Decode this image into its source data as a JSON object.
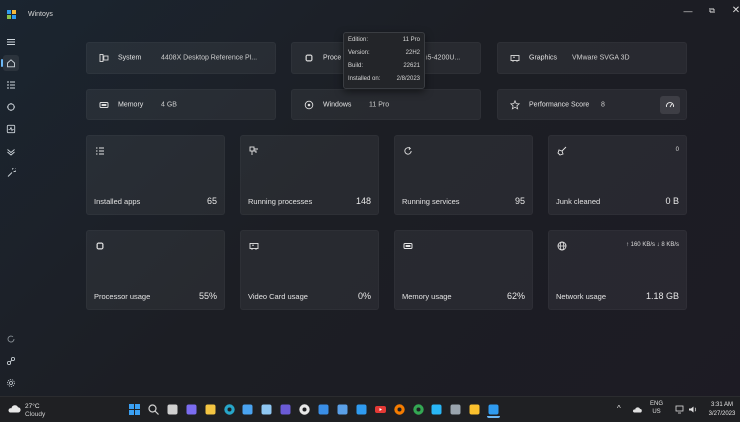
{
  "window": {
    "title": "Wintoys",
    "logo_colors": [
      "#2f9bf0",
      "#f6b93b",
      "#8bc34a",
      "#2f9bf0"
    ],
    "controls": {
      "minimize": "—",
      "maximize": "⧉",
      "close": "✕"
    }
  },
  "accent_color": "#6cb8f6",
  "nav": {
    "top": [
      {
        "name": "menu-icon",
        "active": false
      },
      {
        "name": "home-icon",
        "active": true
      },
      {
        "name": "apps-list-icon",
        "active": false
      },
      {
        "name": "services-icon",
        "active": false
      },
      {
        "name": "health-icon",
        "active": false
      },
      {
        "name": "boost-icon",
        "active": false
      },
      {
        "name": "tweaks-icon",
        "active": false
      }
    ],
    "bottom": [
      {
        "name": "refresh-icon"
      },
      {
        "name": "share-icon"
      },
      {
        "name": "settings-icon"
      }
    ]
  },
  "info": {
    "system": {
      "label": "System",
      "value": "4408X Desktop Reference Pl...",
      "icon": "system-icon"
    },
    "processor": {
      "label": "Proce",
      "value": "i5-4200U...",
      "icon": "processor-icon"
    },
    "graphics": {
      "label": "Graphics",
      "value": "VMware SVGA 3D",
      "icon": "graphics-icon"
    },
    "memory": {
      "label": "Memory",
      "value": "4 GB",
      "icon": "memory-icon"
    },
    "windows": {
      "label": "Windows",
      "value": "11 Pro",
      "icon": "windows-icon"
    },
    "performance": {
      "label": "Performance Score",
      "value": "8",
      "icon": "star-icon",
      "button_icon": "speedometer-icon"
    }
  },
  "tooltip": {
    "rows": [
      {
        "key": "Edition:",
        "value": "11 Pro"
      },
      {
        "key": "Version:",
        "value": "22H2"
      },
      {
        "key": "Build:",
        "value": "22621"
      },
      {
        "key": "Installed on:",
        "value": "2/8/2023"
      }
    ]
  },
  "tiles": [
    {
      "label": "Installed apps",
      "value": "65",
      "corner": "",
      "icon": "list-icon"
    },
    {
      "label": "Running processes",
      "value": "148",
      "corner": "",
      "icon": "processes-icon"
    },
    {
      "label": "Running services",
      "value": "95",
      "corner": "",
      "icon": "services-icon"
    },
    {
      "label": "Junk cleaned",
      "value": "0 B",
      "corner": "0",
      "icon": "broom-icon"
    },
    {
      "label": "Processor usage",
      "value": "55%",
      "corner": "",
      "icon": "cpu-icon"
    },
    {
      "label": "Video Card usage",
      "value": "0%",
      "corner": "",
      "icon": "gpu-icon"
    },
    {
      "label": "Memory usage",
      "value": "62%",
      "corner": "",
      "icon": "ram-icon"
    },
    {
      "label": "Network usage",
      "value": "1.18 GB",
      "corner": "↑ 160 KB/s  ↓ 8 KB/s",
      "icon": "globe-icon"
    }
  ],
  "taskbar": {
    "weather": {
      "temp": "27°C",
      "condition": "Cloudy"
    },
    "language": {
      "line1": "ENG",
      "line2": "US"
    },
    "clock": {
      "time": "3:31 AM",
      "date": "3/27/2023"
    },
    "apps": [
      {
        "name": "start-icon",
        "color": "#3aa0f3"
      },
      {
        "name": "search-icon",
        "color": "#d0d0d0"
      },
      {
        "name": "task-view-icon",
        "color": "#d0d0d0"
      },
      {
        "name": "chat-icon",
        "color": "#7b6cf0"
      },
      {
        "name": "file-explorer-icon",
        "color": "#f4c542"
      },
      {
        "name": "edge-icon",
        "color": "#27a6c9"
      },
      {
        "name": "store-icon",
        "color": "#4aa3f0"
      },
      {
        "name": "notepad-icon",
        "color": "#8fc7f2"
      },
      {
        "name": "app-icon-1",
        "color": "#6b5bd6"
      },
      {
        "name": "media-player-icon",
        "color": "#e8e8e8"
      },
      {
        "name": "app-icon-2",
        "color": "#3a8ee6"
      },
      {
        "name": "notes-icon",
        "color": "#5aa0e8"
      },
      {
        "name": "taskmgr-icon",
        "color": "#2f9bf0"
      },
      {
        "name": "youtube-icon",
        "color": "#e53935"
      },
      {
        "name": "firefox-icon",
        "color": "#f57c00"
      },
      {
        "name": "chrome-icon",
        "color": "#34a853"
      },
      {
        "name": "paint-icon",
        "color": "#29b6f6"
      },
      {
        "name": "settings-app-icon",
        "color": "#9aa4ae"
      },
      {
        "name": "app-icon-3",
        "color": "#fbc02d"
      },
      {
        "name": "wintoys-icon",
        "color": "#2f9bf0"
      }
    ]
  }
}
